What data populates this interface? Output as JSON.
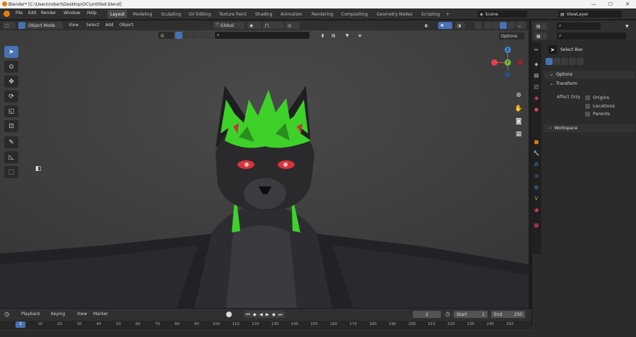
{
  "window": {
    "title": "Blender* [C:\\Users\\robert\\Desktop\\OC\\untitled.blend]",
    "minimize": "—",
    "maximize": "☐",
    "close": "✕"
  },
  "menu": [
    "File",
    "Edit",
    "Render",
    "Window",
    "Help"
  ],
  "workspaces": [
    "Layout",
    "Modeling",
    "Sculpting",
    "UV Editing",
    "Texture Paint",
    "Shading",
    "Animation",
    "Rendering",
    "Compositing",
    "Geometry Nodes",
    "Scripting",
    "+"
  ],
  "scene": {
    "label": "Scene",
    "view_layer": "ViewLayer"
  },
  "viewport_header": {
    "mode": "Object Mode",
    "view": "View",
    "select": "Select",
    "add": "Add",
    "object": "Object",
    "orientation": "Global",
    "options": "Options"
  },
  "properties": {
    "tool_name": "Select Box",
    "options_panel": "Options",
    "transform_panel": "Transform",
    "affect_only": "Affect Only",
    "origins": "Origins",
    "locations": "Locations",
    "parents": "Parents",
    "workspace_panel": "Workspace"
  },
  "timeline": {
    "playback": "Playback",
    "keying": "Keying",
    "view": "View",
    "marker": "Marker",
    "current_frame": "2",
    "start_label": "Start",
    "start": "1",
    "end_label": "End",
    "end": "250",
    "ticks": [
      "2",
      "10",
      "20",
      "30",
      "40",
      "50",
      "60",
      "70",
      "80",
      "90",
      "100",
      "110",
      "120",
      "130",
      "140",
      "150",
      "160",
      "170",
      "180",
      "190",
      "200",
      "210",
      "220",
      "230",
      "240",
      "250"
    ]
  },
  "colors": {
    "accent": "#4772b3",
    "fur_green": "#3ed12a",
    "eyes": "#d8343a",
    "x_axis": "#e0434d",
    "y_axis": "#7bb63a",
    "z_axis": "#3f87d1"
  }
}
